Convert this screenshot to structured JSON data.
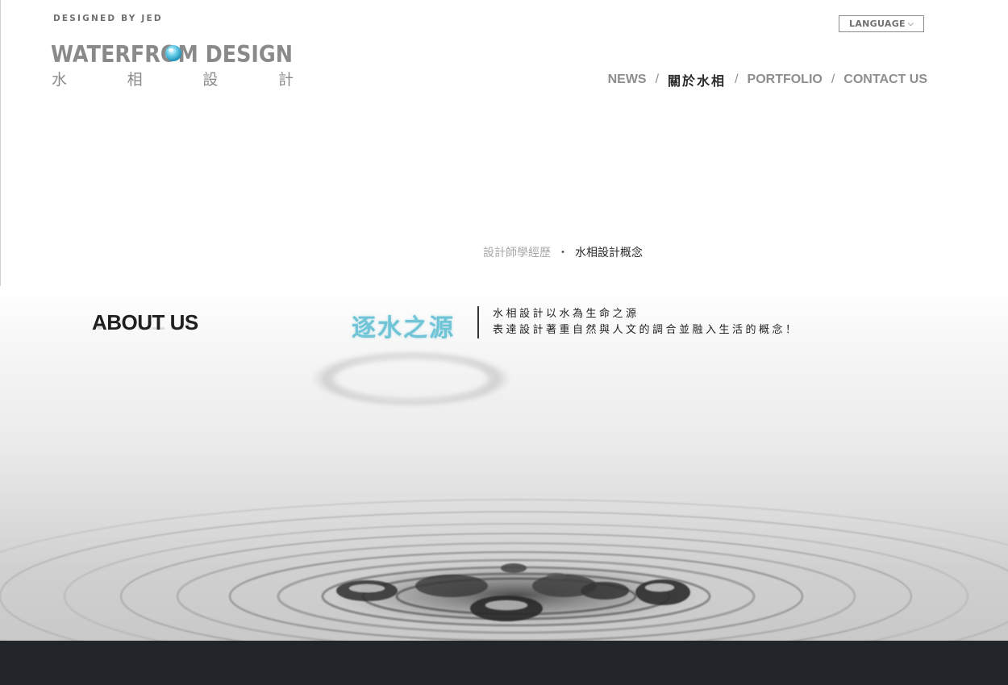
{
  "header": {
    "tagline": "DESIGNED BY JED",
    "logo": {
      "text": "WATERFROM DESIGN",
      "chinese_chars": [
        "水",
        "相",
        "設",
        "計"
      ]
    },
    "language_button": {
      "label": "LANGUAGE",
      "icon": "chevron-down-icon"
    }
  },
  "nav": {
    "items": [
      {
        "label": "NEWS",
        "active": false
      },
      {
        "label": "關於水相",
        "active": true
      },
      {
        "label": "PORTFOLIO",
        "active": false
      },
      {
        "label": "CONTACT US",
        "active": false
      }
    ],
    "separator": "/"
  },
  "subnav": {
    "items": [
      {
        "label": "設計師學經歷",
        "active": false
      },
      {
        "label": "水相設計概念",
        "active": true
      }
    ],
    "separator": "・"
  },
  "about": {
    "title": "ABOUT US",
    "slogan": "逐水之源",
    "description": [
      "水相設計以水為生命之源",
      "表達設計著重自然與人文的調合並融入生活的概念！"
    ]
  },
  "colors": {
    "accent": "#6fc4d6",
    "text_dark": "#2b2b2b",
    "text_muted": "#8e8e8e",
    "footer_bg": "#22262b"
  }
}
